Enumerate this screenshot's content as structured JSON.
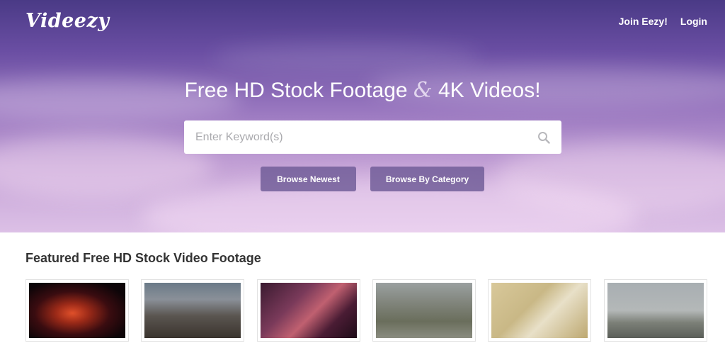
{
  "brand": {
    "logo_text": "Videezy"
  },
  "nav": {
    "join_label": "Join Eezy!",
    "login_label": "Login"
  },
  "hero": {
    "title_part1": "Free HD Stock Footage",
    "title_amp": "&",
    "title_part2": "4K Videos!",
    "search_placeholder": "Enter Keyword(s)",
    "browse_newest_label": "Browse Newest",
    "browse_category_label": "Browse By Category"
  },
  "featured": {
    "title": "Featured Free HD Stock Video Footage",
    "thumbnails": [
      {
        "icon": "abstract-particles-thumbnail"
      },
      {
        "icon": "times-square-thumbnail"
      },
      {
        "icon": "reflective-tiles-thumbnail"
      },
      {
        "icon": "park-bench-thumbnail"
      },
      {
        "icon": "tea-and-cookies-thumbnail"
      },
      {
        "icon": "statue-of-liberty-thumbnail"
      }
    ]
  },
  "colors": {
    "hero_top": "#4a3a86",
    "hero_bottom": "#dcc0e6",
    "button_bg": "#6e5a96",
    "text_dark": "#333333"
  }
}
